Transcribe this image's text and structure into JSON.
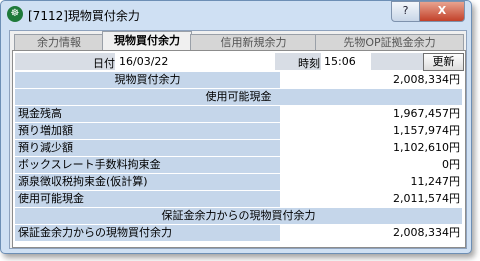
{
  "window": {
    "title": "[7112]現物買付余力",
    "help": "?",
    "close": "X"
  },
  "tabs": [
    "余力情報",
    "現物買付余力",
    "信用新規余力",
    "先物OP証拠金余力"
  ],
  "header": {
    "date_label": "日付",
    "date_value": "16/03/22",
    "time_label": "時刻",
    "time_value": "15:06",
    "update": "更新"
  },
  "buying_power": {
    "label": "現物買付余力",
    "value": "2,008,334円"
  },
  "available_cash_section": "使用可能現金",
  "rows": [
    {
      "label": "現金残高",
      "value": "1,967,457円"
    },
    {
      "label": "預り増加額",
      "value": "1,157,974円"
    },
    {
      "label": "預り減少額",
      "value": "1,102,610円"
    },
    {
      "label": "ボックスレート手数料拘束金",
      "value": "0円"
    },
    {
      "label": "源泉徴収税拘束金(仮計算)",
      "value": "11,247円"
    },
    {
      "label": "使用可能現金",
      "value": "2,011,574円"
    }
  ],
  "margin_section": "保証金余力からの現物買付余力",
  "margin_row": {
    "label": "保証金余力からの現物買付余力",
    "value": "2,008,334円"
  }
}
